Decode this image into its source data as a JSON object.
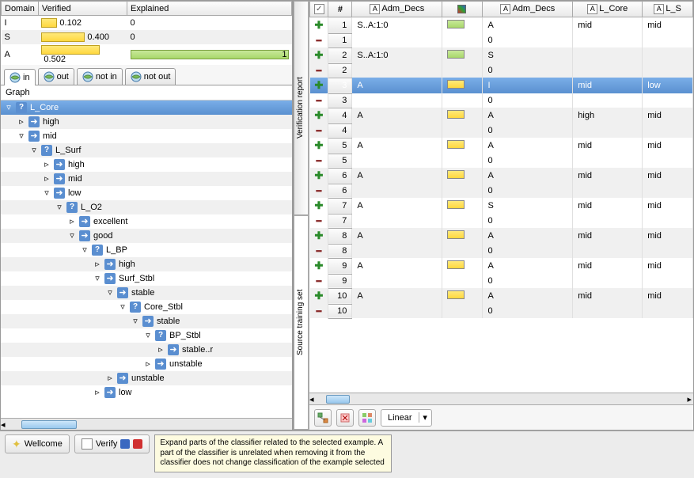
{
  "domain_table": {
    "headers": [
      "Domain",
      "Verified",
      "Explained"
    ],
    "rows": [
      {
        "domain": "I",
        "verified": "0.102",
        "vbar_w": 20,
        "explained": "0",
        "ebar_w": 0
      },
      {
        "domain": "S",
        "verified": "0.400",
        "vbar_w": 55,
        "explained": "0",
        "ebar_w": 0
      },
      {
        "domain": "A",
        "verified": "0.502",
        "vbar_w": 74,
        "explained": "1",
        "ebar_w": 200
      }
    ]
  },
  "tabs": [
    {
      "label": "in",
      "active": true
    },
    {
      "label": "out",
      "active": false
    },
    {
      "label": "not in",
      "active": false
    },
    {
      "label": "not out",
      "active": false
    }
  ],
  "graph_label": "Graph",
  "tree": [
    {
      "depth": 0,
      "exp": "down",
      "icon": "q",
      "label": "L_Core",
      "sel": true
    },
    {
      "depth": 1,
      "exp": "right",
      "icon": "a",
      "label": "high"
    },
    {
      "depth": 1,
      "exp": "down",
      "icon": "a",
      "label": "mid"
    },
    {
      "depth": 2,
      "exp": "down",
      "icon": "q",
      "label": "L_Surf"
    },
    {
      "depth": 3,
      "exp": "right",
      "icon": "a",
      "label": "high"
    },
    {
      "depth": 3,
      "exp": "right",
      "icon": "a",
      "label": "mid"
    },
    {
      "depth": 3,
      "exp": "down",
      "icon": "a",
      "label": "low"
    },
    {
      "depth": 4,
      "exp": "down",
      "icon": "q",
      "label": "L_O2"
    },
    {
      "depth": 5,
      "exp": "right",
      "icon": "a",
      "label": "excellent"
    },
    {
      "depth": 5,
      "exp": "down",
      "icon": "a",
      "label": "good"
    },
    {
      "depth": 6,
      "exp": "down",
      "icon": "q",
      "label": "L_BP"
    },
    {
      "depth": 7,
      "exp": "right",
      "icon": "a",
      "label": "high"
    },
    {
      "depth": 7,
      "exp": "down",
      "icon": "a",
      "label": "Surf_Stbl"
    },
    {
      "depth": 8,
      "exp": "down",
      "icon": "a",
      "label": "stable"
    },
    {
      "depth": 9,
      "exp": "down",
      "icon": "q",
      "label": "Core_Stbl"
    },
    {
      "depth": 10,
      "exp": "down",
      "icon": "a",
      "label": "stable"
    },
    {
      "depth": 11,
      "exp": "down",
      "icon": "q",
      "label": "BP_Stbl"
    },
    {
      "depth": 12,
      "exp": "right",
      "icon": "a",
      "label": "stable..r"
    },
    {
      "depth": 11,
      "exp": "right",
      "icon": "a",
      "label": "unstable"
    },
    {
      "depth": 8,
      "exp": "right",
      "icon": "a",
      "label": "unstable"
    },
    {
      "depth": 7,
      "exp": "right",
      "icon": "a",
      "label": "low"
    }
  ],
  "vtabs": [
    {
      "label": "Verification report",
      "active": false
    },
    {
      "label": "Source training set",
      "active": true
    }
  ],
  "data_headers": {
    "c1": "",
    "c2": "",
    "c3": "Adm_Decs",
    "c4": "",
    "c5": "Adm_Decs",
    "c6": "L_Core",
    "c7": "L_S"
  },
  "data_rows": [
    {
      "n": "1",
      "a": "+",
      "adm": "S..A:1:0",
      "chip": "green",
      "adm2": "A",
      "lc": "mid",
      "ls": "mid"
    },
    {
      "n": "1",
      "a": "-",
      "adm": "",
      "chip": "",
      "adm2": "0",
      "lc": "",
      "ls": ""
    },
    {
      "n": "2",
      "a": "+",
      "adm": "S..A:1:0",
      "chip": "green",
      "adm2": "S",
      "lc": "",
      "ls": ""
    },
    {
      "n": "2",
      "a": "-",
      "adm": "",
      "chip": "",
      "adm2": "0",
      "lc": "",
      "ls": ""
    },
    {
      "n": "3",
      "a": "+",
      "adm": "A",
      "chip": "yellow",
      "adm2": "I",
      "lc": "mid",
      "ls": "low",
      "sel": true
    },
    {
      "n": "3",
      "a": "-",
      "adm": "",
      "chip": "",
      "adm2": "0",
      "lc": "",
      "ls": ""
    },
    {
      "n": "4",
      "a": "+",
      "adm": "A",
      "chip": "yellow",
      "adm2": "A",
      "lc": "high",
      "ls": "mid"
    },
    {
      "n": "4",
      "a": "-",
      "adm": "",
      "chip": "",
      "adm2": "0",
      "lc": "",
      "ls": ""
    },
    {
      "n": "5",
      "a": "+",
      "adm": "A",
      "chip": "yellow",
      "adm2": "A",
      "lc": "mid",
      "ls": "mid"
    },
    {
      "n": "5",
      "a": "-",
      "adm": "",
      "chip": "",
      "adm2": "0",
      "lc": "",
      "ls": ""
    },
    {
      "n": "6",
      "a": "+",
      "adm": "A",
      "chip": "yellow",
      "adm2": "A",
      "lc": "mid",
      "ls": "mid"
    },
    {
      "n": "6",
      "a": "-",
      "adm": "",
      "chip": "",
      "adm2": "0",
      "lc": "",
      "ls": ""
    },
    {
      "n": "7",
      "a": "+",
      "adm": "A",
      "chip": "yellow",
      "adm2": "S",
      "lc": "mid",
      "ls": "mid"
    },
    {
      "n": "7",
      "a": "-",
      "adm": "",
      "chip": "",
      "adm2": "0",
      "lc": "",
      "ls": ""
    },
    {
      "n": "8",
      "a": "+",
      "adm": "A",
      "chip": "yellow",
      "adm2": "A",
      "lc": "mid",
      "ls": "mid"
    },
    {
      "n": "8",
      "a": "-",
      "adm": "",
      "chip": "",
      "adm2": "0",
      "lc": "",
      "ls": ""
    },
    {
      "n": "9",
      "a": "+",
      "adm": "A",
      "chip": "yellow",
      "adm2": "A",
      "lc": "mid",
      "ls": "mid"
    },
    {
      "n": "9",
      "a": "-",
      "adm": "",
      "chip": "",
      "adm2": "0",
      "lc": "",
      "ls": ""
    },
    {
      "n": "10",
      "a": "+",
      "adm": "A",
      "chip": "yellow",
      "adm2": "A",
      "lc": "mid",
      "ls": "mid"
    },
    {
      "n": "10",
      "a": "-",
      "adm": "",
      "chip": "",
      "adm2": "0",
      "lc": "",
      "ls": ""
    }
  ],
  "combo_value": "Linear",
  "status": {
    "wellcome": "Wellcome",
    "verify": "Verify",
    "tooltip": "Expand parts of the classifier related to the selected example. A part of the classifier is unrelated when removing it from the classifier does not change classification of the example selected"
  }
}
